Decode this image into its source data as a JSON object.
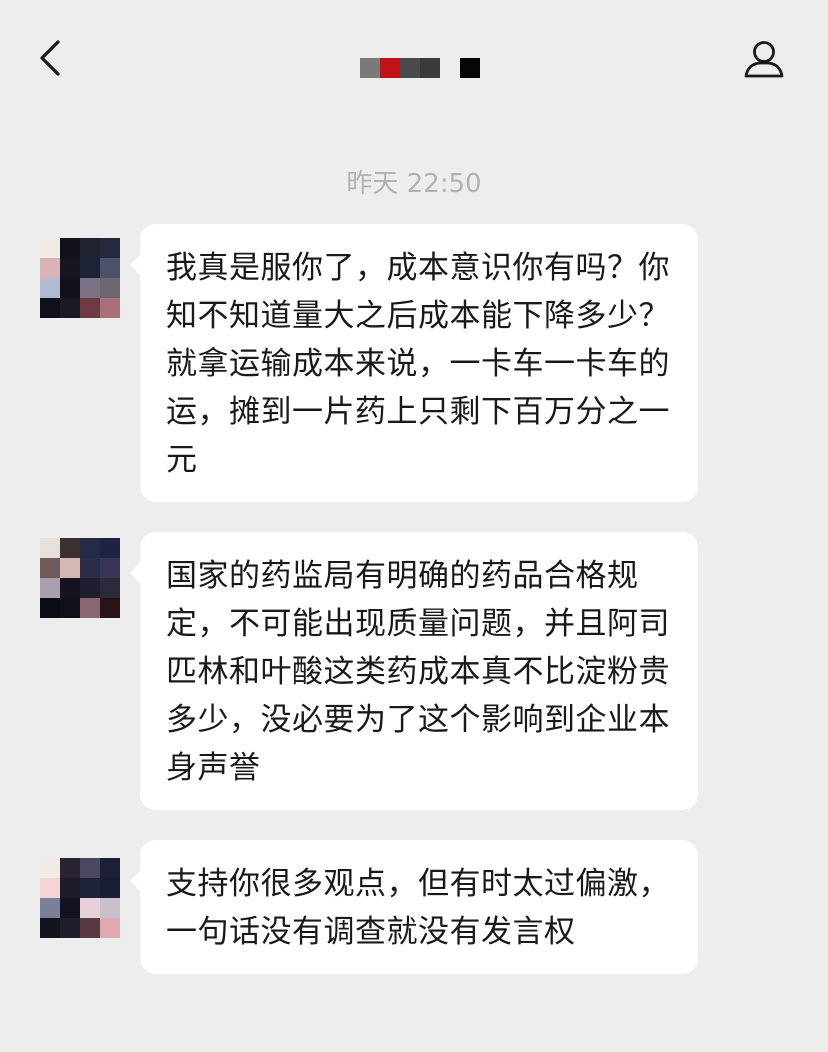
{
  "header": {
    "title_redacted": true,
    "back_icon": "chevron-left-icon",
    "profile_icon": "person-icon"
  },
  "timestamp": "昨天 22:50",
  "colors": {
    "background": "#ededed",
    "bubble": "#ffffff",
    "text": "#191919",
    "timestamp": "#b2b2b2"
  },
  "messages": [
    {
      "sender": "incoming",
      "text": "我真是服你了，成本意识你有吗？你知不知道量大之后成本能下降多少？就拿运输成本来说，一卡车一卡车的运，摊到一片药上只剩下百万分之一元"
    },
    {
      "sender": "incoming",
      "text": "国家的药监局有明确的药品合格规定，不可能出现质量问题，并且阿司匹林和叶酸这类药成本真不比淀粉贵多少，没必要为了这个影响到企业本身声誉"
    },
    {
      "sender": "incoming",
      "text": "支持你很多观点，但有时太过偏激，一句话没有调查就没有发言权"
    }
  ]
}
